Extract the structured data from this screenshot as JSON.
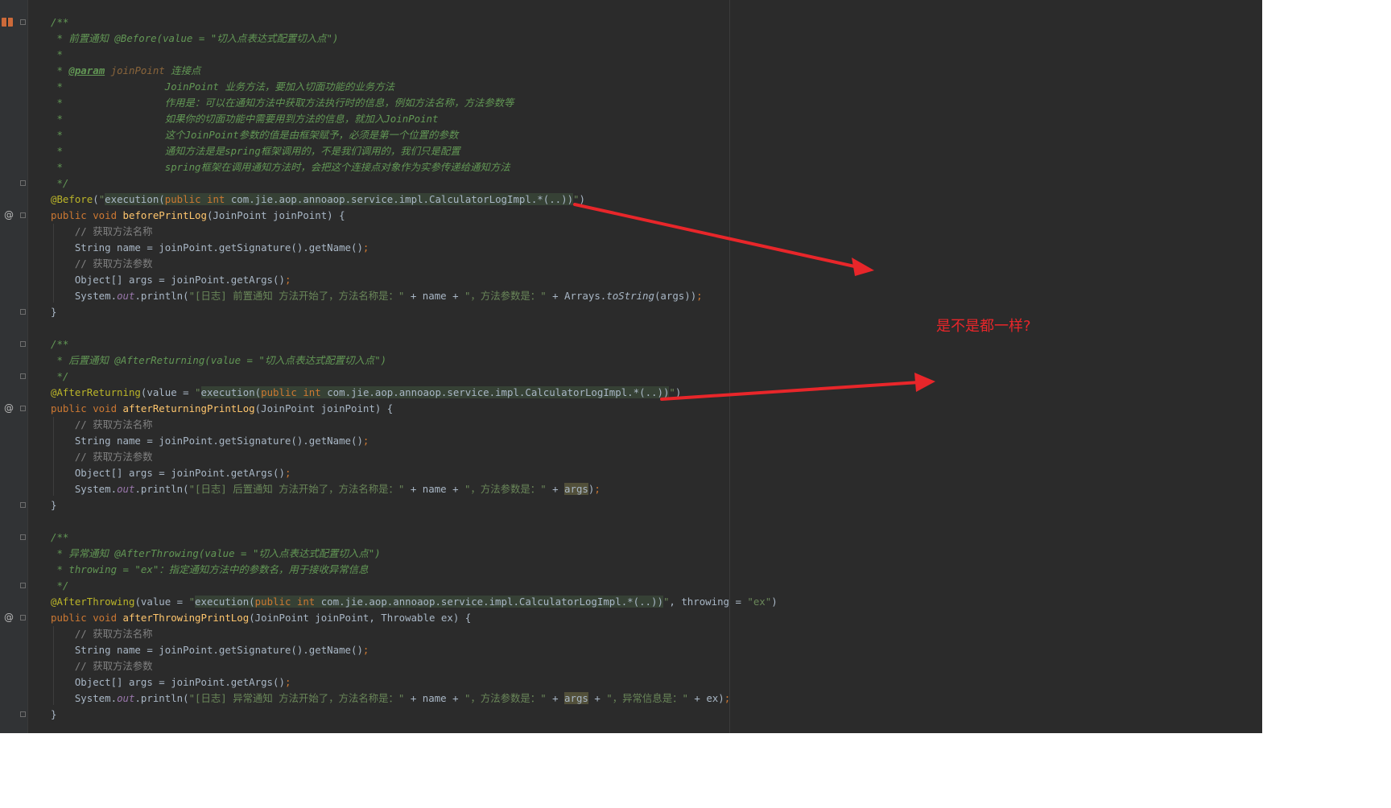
{
  "annotation": {
    "text": "是不是都一样?",
    "color": "#e8262a"
  },
  "lines": [
    [
      [
        "/**",
        "doc"
      ]
    ],
    [
      [
        " * 前置通知 @Before(value = \"切入点表达式配置切入点\")",
        "doc"
      ]
    ],
    [
      [
        " *",
        "doc"
      ]
    ],
    [
      [
        " * ",
        "doc"
      ],
      [
        "@param",
        "tag"
      ],
      [
        " ",
        "doc"
      ],
      [
        "joinPoint",
        "param"
      ],
      [
        " 连接点",
        "doc"
      ]
    ],
    [
      [
        " *                 JoinPoint 业务方法，要加入切面功能的业务方法",
        "doc"
      ]
    ],
    [
      [
        " *                 作用是：可以在通知方法中获取方法执行时的信息，例如方法名称，方法参数等",
        "doc"
      ]
    ],
    [
      [
        " *                 如果你的切面功能中需要用到方法的信息，就加入JoinPoint",
        "doc"
      ]
    ],
    [
      [
        " *                 这个JoinPoint参数的值是由框架赋予，必须是第一个位置的参数",
        "doc"
      ]
    ],
    [
      [
        " *                 通知方法是是spring框架调用的，不是我们调用的，我们只是配置",
        "doc"
      ]
    ],
    [
      [
        " *                 spring框架在调用通知方法时，会把这个连接点对象作为实参传递给通知方法",
        "doc"
      ]
    ],
    [
      [
        " */",
        "doc"
      ]
    ],
    [
      [
        "@Before",
        "ann"
      ],
      [
        "(",
        "txt"
      ],
      [
        "\"",
        "str"
      ],
      [
        "execution(",
        "inj"
      ],
      [
        "public int",
        "injkw"
      ],
      [
        " com.jie.aop.annoaop.service.impl.CalculatorLogImpl.*(..))",
        "inj"
      ],
      [
        "\"",
        "str"
      ],
      [
        ")",
        "txt"
      ]
    ],
    [
      [
        "public void ",
        "kw"
      ],
      [
        "beforePrintLog",
        "fn"
      ],
      [
        "(JoinPoint joinPoint) {",
        "txt"
      ]
    ],
    [
      [
        "    // 获取方法名称",
        "cmt"
      ]
    ],
    [
      [
        "    String name = joinPoint.getSignature().getName()",
        "txt"
      ],
      [
        ";",
        "kw"
      ]
    ],
    [
      [
        "    // 获取方法参数",
        "cmt"
      ]
    ],
    [
      [
        "    Object[] args = joinPoint.getArgs()",
        "txt"
      ],
      [
        ";",
        "kw"
      ]
    ],
    [
      [
        "    System.",
        "txt"
      ],
      [
        "out",
        "static"
      ],
      [
        ".println(",
        "txt"
      ],
      [
        "\"[日志] 前置通知 方法开始了，方法名称是：\"",
        "str"
      ],
      [
        " + name + ",
        "txt"
      ],
      [
        "\"，方法参数是：\"",
        "str"
      ],
      [
        " + Arrays.",
        "txt"
      ],
      [
        "toString",
        "it"
      ],
      [
        "(args))",
        "txt"
      ],
      [
        ";",
        "kw"
      ]
    ],
    [
      [
        "}",
        "txt"
      ]
    ],
    [
      [
        "",
        "txt"
      ]
    ],
    [
      [
        "/**",
        "doc"
      ]
    ],
    [
      [
        " * 后置通知 @AfterReturning(value = \"切入点表达式配置切入点\")",
        "doc"
      ]
    ],
    [
      [
        " */",
        "doc"
      ]
    ],
    [
      [
        "@AfterReturning",
        "ann"
      ],
      [
        "(value = ",
        "txt"
      ],
      [
        "\"",
        "str"
      ],
      [
        "execution(",
        "inj"
      ],
      [
        "public int",
        "injkw"
      ],
      [
        " com.jie.aop.annoaop.service.impl.CalculatorLogImpl.*(..))",
        "inj"
      ],
      [
        "\"",
        "str"
      ],
      [
        ")",
        "txt"
      ]
    ],
    [
      [
        "public void ",
        "kw"
      ],
      [
        "afterReturningPrintLog",
        "fn"
      ],
      [
        "(JoinPoint joinPoint) {",
        "txt"
      ]
    ],
    [
      [
        "    // 获取方法名称",
        "cmt"
      ]
    ],
    [
      [
        "    String name = joinPoint.getSignature().getName()",
        "txt"
      ],
      [
        ";",
        "kw"
      ]
    ],
    [
      [
        "    // 获取方法参数",
        "cmt"
      ]
    ],
    [
      [
        "    Object[] args = joinPoint.getArgs()",
        "txt"
      ],
      [
        ";",
        "kw"
      ]
    ],
    [
      [
        "    System.",
        "txt"
      ],
      [
        "out",
        "static"
      ],
      [
        ".println(",
        "txt"
      ],
      [
        "\"[日志] 后置通知 方法开始了，方法名称是：\"",
        "str"
      ],
      [
        " + name + ",
        "txt"
      ],
      [
        "\"，方法参数是：\"",
        "str"
      ],
      [
        " + ",
        "txt"
      ],
      [
        "args",
        "hl"
      ],
      [
        ")",
        "txt"
      ],
      [
        ";",
        "kw"
      ]
    ],
    [
      [
        "}",
        "txt"
      ]
    ],
    [
      [
        "",
        "txt"
      ]
    ],
    [
      [
        "/**",
        "doc"
      ]
    ],
    [
      [
        " * 异常通知 @AfterThrowing(value = \"切入点表达式配置切入点\")",
        "doc"
      ]
    ],
    [
      [
        " * throwing = \"ex\"：指定通知方法中的参数名，用于接收异常信息",
        "doc"
      ]
    ],
    [
      [
        " */",
        "doc"
      ]
    ],
    [
      [
        "@AfterThrowing",
        "ann"
      ],
      [
        "(value = ",
        "txt"
      ],
      [
        "\"",
        "str"
      ],
      [
        "execution(",
        "inj"
      ],
      [
        "public int",
        "injkw"
      ],
      [
        " com.jie.aop.annoaop.service.impl.CalculatorLogImpl.*(..))",
        "inj"
      ],
      [
        "\"",
        "str"
      ],
      [
        ", throwing = ",
        "txt"
      ],
      [
        "\"ex\"",
        "str"
      ],
      [
        ")",
        "txt"
      ]
    ],
    [
      [
        "public void ",
        "kw"
      ],
      [
        "afterThrowingPrintLog",
        "fn"
      ],
      [
        "(JoinPoint joinPoint, Throwable ex) {",
        "txt"
      ]
    ],
    [
      [
        "    // 获取方法名称",
        "cmt"
      ]
    ],
    [
      [
        "    String name = joinPoint.getSignature().getName()",
        "txt"
      ],
      [
        ";",
        "kw"
      ]
    ],
    [
      [
        "    // 获取方法参数",
        "cmt"
      ]
    ],
    [
      [
        "    Object[] args = joinPoint.getArgs()",
        "txt"
      ],
      [
        ";",
        "kw"
      ]
    ],
    [
      [
        "    System.",
        "txt"
      ],
      [
        "out",
        "static"
      ],
      [
        ".println(",
        "txt"
      ],
      [
        "\"[日志] 异常通知 方法开始了，方法名称是：\"",
        "str"
      ],
      [
        " + name + ",
        "txt"
      ],
      [
        "\"，方法参数是：\"",
        "str"
      ],
      [
        " + ",
        "txt"
      ],
      [
        "args",
        "hl"
      ],
      [
        " + ",
        "txt"
      ],
      [
        "\"，异常信息是：\"",
        "str"
      ],
      [
        " + ex)",
        "txt"
      ],
      [
        ";",
        "kw"
      ]
    ],
    [
      [
        "}",
        "txt"
      ]
    ]
  ],
  "gutter": {
    "at_markers": [
      "@",
      "@",
      "@"
    ],
    "icons": [
      "bookmark-icon",
      "fold-icon",
      "implements-icon"
    ]
  }
}
